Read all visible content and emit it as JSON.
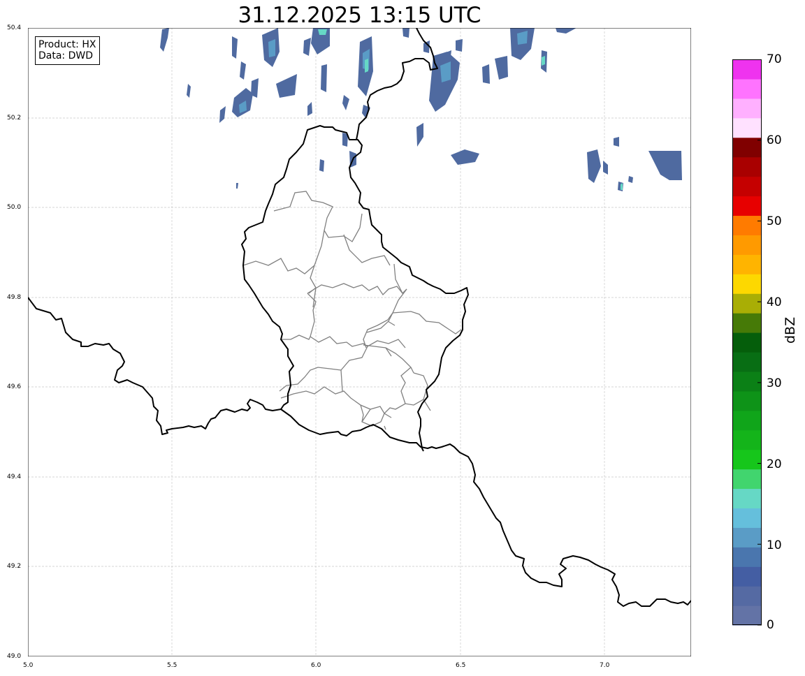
{
  "title": "31.12.2025 13:15 UTC",
  "info_box": {
    "product": "Product: HX",
    "source": "Data: DWD"
  },
  "map": {
    "lon_range": [
      5.0,
      7.3
    ],
    "lat_range": [
      49.0,
      50.4
    ],
    "lon_ticks": [
      "5.0",
      "5.5",
      "6.0",
      "6.5",
      "7.0"
    ],
    "lat_ticks": [
      "50.4",
      "50.2",
      "50.0",
      "49.8",
      "49.6",
      "49.4",
      "49.2",
      "49.0"
    ],
    "grid": true,
    "country_border_color": "#000000",
    "district_border_color": "#808080"
  },
  "colorbar": {
    "label": "dBZ",
    "tick_labels": [
      "0",
      "10",
      "20",
      "30",
      "40",
      "50",
      "60",
      "70"
    ],
    "range": [
      0,
      70
    ],
    "step": 2.5,
    "colors": [
      "#6373a6",
      "#556aa3",
      "#445ea3",
      "#4a76ae",
      "#5a9cc6",
      "#65bfdc",
      "#66d8c5",
      "#41d56e",
      "#16c61b",
      "#14b41a",
      "#10a51a",
      "#0e9318",
      "#0b8016",
      "#086e14",
      "#055e0b",
      "#467a07",
      "#a9ae05",
      "#fdd800",
      "#ffb400",
      "#ff9a00",
      "#ff7b00",
      "#e70000",
      "#c50000",
      "#a90000",
      "#800000",
      "#ffe1ff",
      "#ffb0ff",
      "#ff73ff",
      "#ef33ef"
    ]
  }
}
